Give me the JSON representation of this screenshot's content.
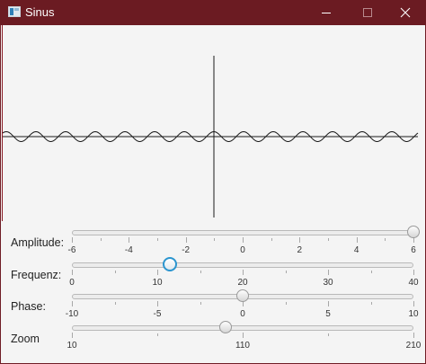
{
  "window": {
    "title": "Sinus",
    "icon": "java-app-icon",
    "controls": [
      "minimize-icon",
      "maximize-icon",
      "close-icon"
    ],
    "titlebar_color": "#6b1b22"
  },
  "plot": {
    "description_colors": {
      "axis": "#1a1a1a",
      "curve": "#1a1a1a"
    },
    "cycles_visible": 14
  },
  "sliders": [
    {
      "label": "Amplitude:",
      "min": -6,
      "max": 6,
      "value": 6,
      "focused": false,
      "tick_labels": [
        "-6",
        "-4",
        "-2",
        "0",
        "2",
        "4",
        "6"
      ]
    },
    {
      "label": "Frequenz:",
      "min": 0,
      "max": 40,
      "value": 11.5,
      "focused": true,
      "tick_labels": [
        "0",
        "10",
        "20",
        "30",
        "40"
      ]
    },
    {
      "label": "Phase:",
      "min": -10,
      "max": 10,
      "value": 0,
      "focused": false,
      "tick_labels": [
        "-10",
        "-5",
        "0",
        "5",
        "10"
      ]
    },
    {
      "label": "Zoom",
      "min": 10,
      "max": 210,
      "value": 100,
      "focused": false,
      "tick_labels": [
        "10",
        "110",
        "210"
      ]
    }
  ]
}
